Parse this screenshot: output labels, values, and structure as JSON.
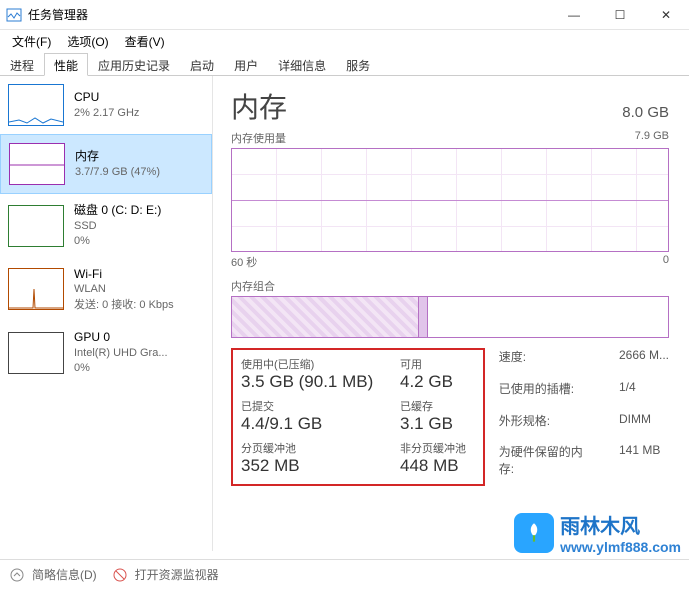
{
  "window": {
    "title": "任务管理器",
    "min": "—",
    "max": "☐",
    "close": "✕"
  },
  "menu": {
    "file": "文件(F)",
    "options": "选项(O)",
    "view": "查看(V)"
  },
  "tabs": {
    "items": [
      "进程",
      "性能",
      "应用历史记录",
      "启动",
      "用户",
      "详细信息",
      "服务"
    ],
    "active": 1
  },
  "sidebar": {
    "items": [
      {
        "title": "CPU",
        "sub": "2% 2.17 GHz"
      },
      {
        "title": "内存",
        "sub": "3.7/7.9 GB (47%)"
      },
      {
        "title": "磁盘 0 (C: D: E:)",
        "sub": "SSD",
        "sub2": "0%"
      },
      {
        "title": "Wi-Fi",
        "sub": "WLAN",
        "sub2": "发送: 0 接收: 0 Kbps"
      },
      {
        "title": "GPU 0",
        "sub": "Intel(R) UHD Gra...",
        "sub2": "0%"
      }
    ],
    "selected": 1
  },
  "main": {
    "title": "内存",
    "total": "8.0 GB",
    "usage_label": "内存使用量",
    "usage_max": "7.9 GB",
    "axis_left": "60 秒",
    "axis_right": "0",
    "composition_label": "内存组合",
    "stats": {
      "in_use_lbl": "使用中(已压缩)",
      "in_use_val": "3.5 GB (90.1 MB)",
      "available_lbl": "可用",
      "available_val": "4.2 GB",
      "committed_lbl": "已提交",
      "committed_val": "4.4/9.1 GB",
      "cached_lbl": "已缓存",
      "cached_val": "3.1 GB",
      "paged_lbl": "分页缓冲池",
      "paged_val": "352 MB",
      "nonpaged_lbl": "非分页缓冲池",
      "nonpaged_val": "448 MB"
    },
    "right": {
      "speed_lbl": "速度:",
      "speed_val": "2666 M...",
      "slots_lbl": "已使用的插槽:",
      "slots_val": "1/4",
      "form_lbl": "外形规格:",
      "form_val": "DIMM",
      "reserved_lbl": "为硬件保留的内存:",
      "reserved_val": "141 MB"
    }
  },
  "footer": {
    "less": "简略信息(D)",
    "resmon": "打开资源监视器"
  },
  "watermark": {
    "cn": "雨林木风",
    "url": "www.ylmf888.com"
  },
  "chart_data": {
    "type": "line",
    "title": "内存使用量",
    "x_range_seconds": [
      60,
      0
    ],
    "y_range_gb": [
      0,
      7.9
    ],
    "series": [
      {
        "name": "Memory",
        "approx_flat_value_gb": 3.7
      }
    ],
    "composition_bar": {
      "in_use_gb": 3.5,
      "cached_gb": 3.1,
      "available_gb": 4.2,
      "total_gb": 7.9
    }
  }
}
